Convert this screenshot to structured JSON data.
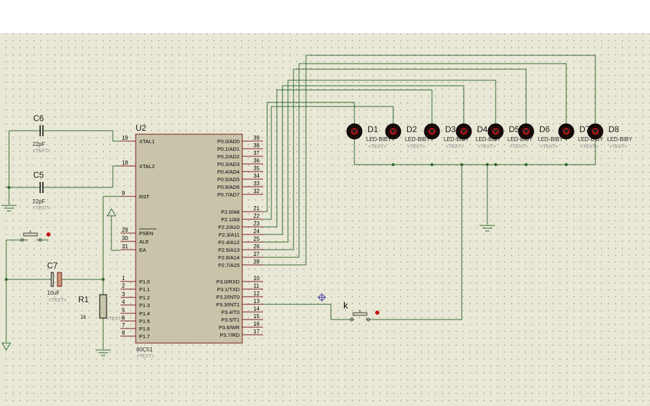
{
  "chip": {
    "ref": "U2",
    "part": "80C51",
    "text": "<TEXT>",
    "left_pins": [
      {
        "num": "19",
        "label": "XTAL1"
      },
      {
        "num": "18",
        "label": "XTAL2"
      },
      {
        "num": "9",
        "label": "RST"
      },
      {
        "num": "29",
        "label": "PSEN"
      },
      {
        "num": "30",
        "label": "ALE"
      },
      {
        "num": "31",
        "label": "EA"
      },
      {
        "num": "1",
        "label": "P1.0"
      },
      {
        "num": "2",
        "label": "P1.1"
      },
      {
        "num": "3",
        "label": "P1.2"
      },
      {
        "num": "4",
        "label": "P1.3"
      },
      {
        "num": "5",
        "label": "P1.4"
      },
      {
        "num": "6",
        "label": "P1.5"
      },
      {
        "num": "7",
        "label": "P1.6"
      },
      {
        "num": "8",
        "label": "P1.7"
      }
    ],
    "right_pins": [
      {
        "num": "39",
        "label": "P0.0/AD0"
      },
      {
        "num": "38",
        "label": "P0.1/AD1"
      },
      {
        "num": "37",
        "label": "P0.2/AD2"
      },
      {
        "num": "36",
        "label": "P0.3/AD3"
      },
      {
        "num": "35",
        "label": "P0.4/AD4"
      },
      {
        "num": "34",
        "label": "P0.5/AD5"
      },
      {
        "num": "33",
        "label": "P0.6/AD6"
      },
      {
        "num": "32",
        "label": "P0.7/AD7"
      },
      {
        "num": "21",
        "label": "P2.0/A8"
      },
      {
        "num": "22",
        "label": "P2.1/A9"
      },
      {
        "num": "23",
        "label": "P2.2/A10"
      },
      {
        "num": "24",
        "label": "P2.3/A11"
      },
      {
        "num": "25",
        "label": "P2.4/A12"
      },
      {
        "num": "26",
        "label": "P2.5/A13"
      },
      {
        "num": "27",
        "label": "P2.6/A14"
      },
      {
        "num": "28",
        "label": "P2.7/A15"
      },
      {
        "num": "10",
        "label": "P3.0/RXD"
      },
      {
        "num": "11",
        "label": "P3.1/TXD"
      },
      {
        "num": "12",
        "label": "P3.2/INT0"
      },
      {
        "num": "13",
        "label": "P3.3/INT1"
      },
      {
        "num": "14",
        "label": "P3.4/T0"
      },
      {
        "num": "15",
        "label": "P3.5/T1"
      },
      {
        "num": "16",
        "label": "P3.6/WR"
      },
      {
        "num": "17",
        "label": "P3.7/RD"
      }
    ]
  },
  "capacitors": [
    {
      "ref": "C6",
      "value": "22pF",
      "text": "<TEXT>"
    },
    {
      "ref": "C5",
      "value": "22pF",
      "text": "<TEXT>"
    },
    {
      "ref": "C7",
      "value": "10uF",
      "text": "<TEXT>"
    }
  ],
  "resistor": {
    "ref": "R1",
    "value": "1k",
    "text": "<TEXT>"
  },
  "switch_k": {
    "ref": "k"
  },
  "leds": [
    {
      "ref": "D1",
      "part": "LED-BIBY",
      "text": "<TEXT>"
    },
    {
      "ref": "D2",
      "part": "LED-BIBY",
      "text": "<TEXT>"
    },
    {
      "ref": "D3",
      "part": "LED-BIBY",
      "text": "<TEXT>"
    },
    {
      "ref": "D4",
      "part": "LED-BIBY",
      "text": "<TEXT>"
    },
    {
      "ref": "D5",
      "part": "LED-BIBY",
      "text": "<TEXT>"
    },
    {
      "ref": "D6",
      "part": "LED-BIBY",
      "text": "<TEXT>"
    },
    {
      "ref": "D7",
      "part": "LED-BIBY",
      "text": "<TEXT>"
    },
    {
      "ref": "D8",
      "part": "LED-BIBY",
      "text": "<TEXT>"
    }
  ],
  "colors": {
    "wire": "#2f6b2f",
    "body": "#c9c3aa",
    "outline": "#7a1a1a",
    "led": "#1a0a0a",
    "led_glow": "#d01010",
    "background": "#e9e7d6"
  }
}
